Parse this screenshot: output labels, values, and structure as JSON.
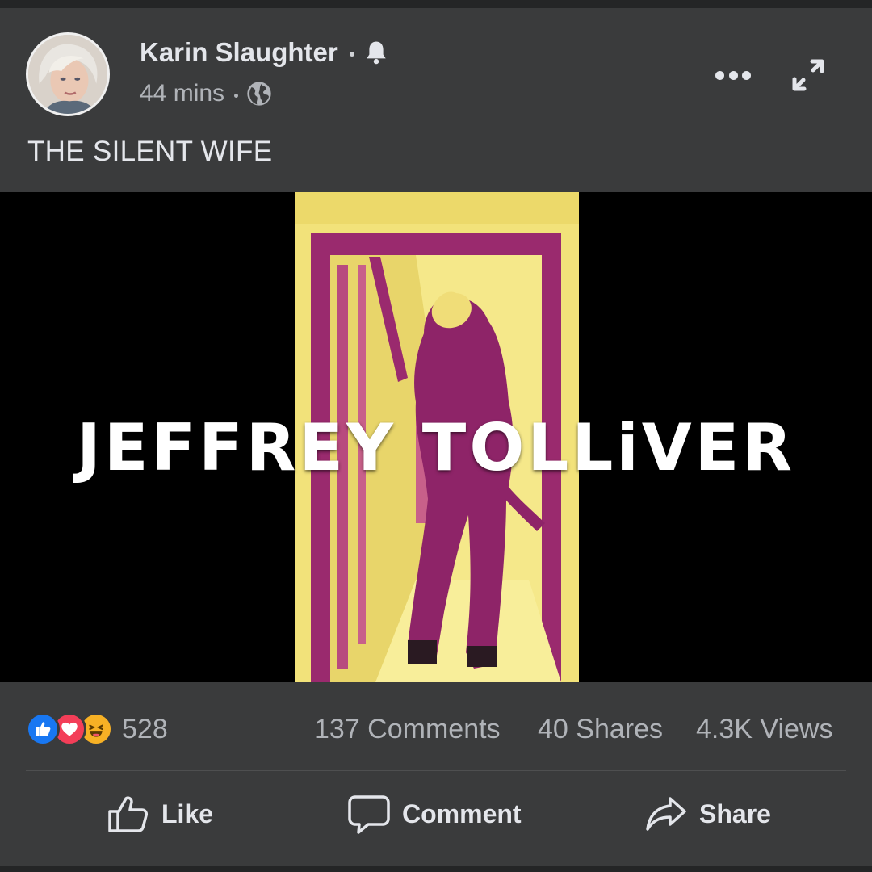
{
  "post": {
    "author": "Karin Slaughter",
    "time": "44 mins",
    "caption": "THE SILENT WIFE"
  },
  "video": {
    "overlay_title": "JEFFREY TOLLiVER"
  },
  "stats": {
    "reactions_count": "528",
    "comments": "137 Comments",
    "shares": "40 Shares",
    "views": "4.3K Views"
  },
  "actions": {
    "like": "Like",
    "comment": "Comment",
    "share": "Share"
  },
  "colors": {
    "background": "#3a3b3c",
    "text_primary": "#e4e6eb",
    "text_secondary": "#b0b3b8",
    "like_blue": "#1877f2",
    "love_red": "#f33e58",
    "haha_yellow": "#f7b125",
    "video_yellow": "#f2e27a",
    "video_magenta": "#9a2a6e"
  },
  "icons": {
    "notifications": "bell-icon",
    "audience": "globe-icon",
    "menu": "more-options-icon",
    "fullscreen": "expand-icon",
    "like": "thumbs-up-icon",
    "comment": "comment-bubble-icon",
    "share": "share-arrow-icon"
  }
}
